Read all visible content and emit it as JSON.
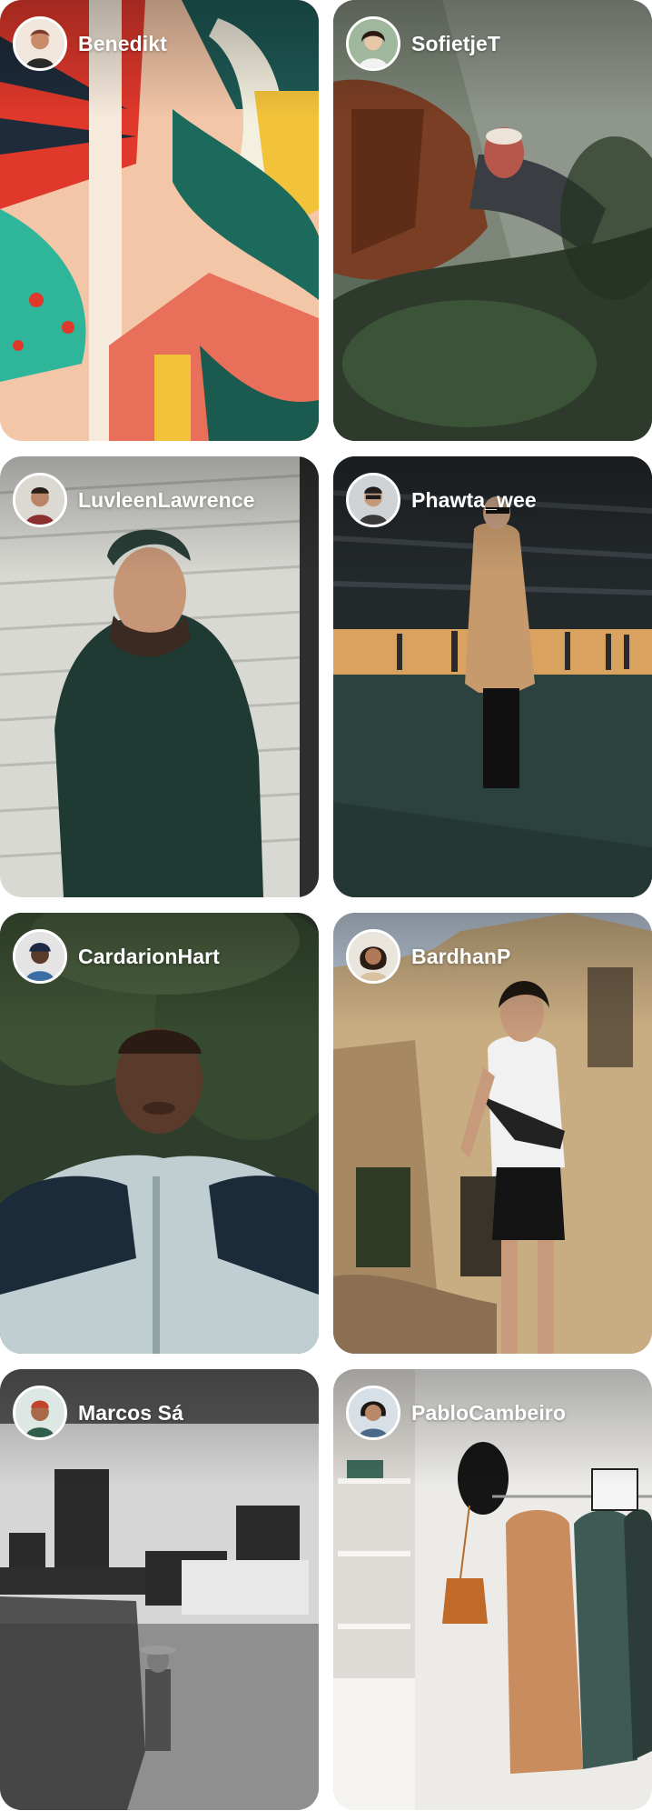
{
  "feed": {
    "cards": [
      {
        "username": "Benedikt",
        "photo": "abstract-mural-photo",
        "avatar_color": "#c98b6a"
      },
      {
        "username": "SofietjeT",
        "photo": "leather-jacket-coffee-photo",
        "avatar_color": "#6b4a3a"
      },
      {
        "username": "LuvleenLawrence",
        "photo": "hoodie-brick-wall-photo",
        "avatar_color": "#7a5a48"
      },
      {
        "username": "Phawta_wee",
        "photo": "trench-coat-parking-photo",
        "avatar_color": "#4a4a4a"
      },
      {
        "username": "CardarionHart",
        "photo": "zip-jacket-trees-photo",
        "avatar_color": "#3d2a22"
      },
      {
        "username": "BardhanP",
        "photo": "ruins-teen-photo",
        "avatar_color": "#6a4a36"
      },
      {
        "username": "Marcos Sá",
        "photo": "street-mural-bw-photo",
        "avatar_color": "#2f5f4a"
      },
      {
        "username": "PabloCambeiro",
        "photo": "clothes-rack-photo",
        "avatar_color": "#4a6a8a"
      }
    ]
  }
}
